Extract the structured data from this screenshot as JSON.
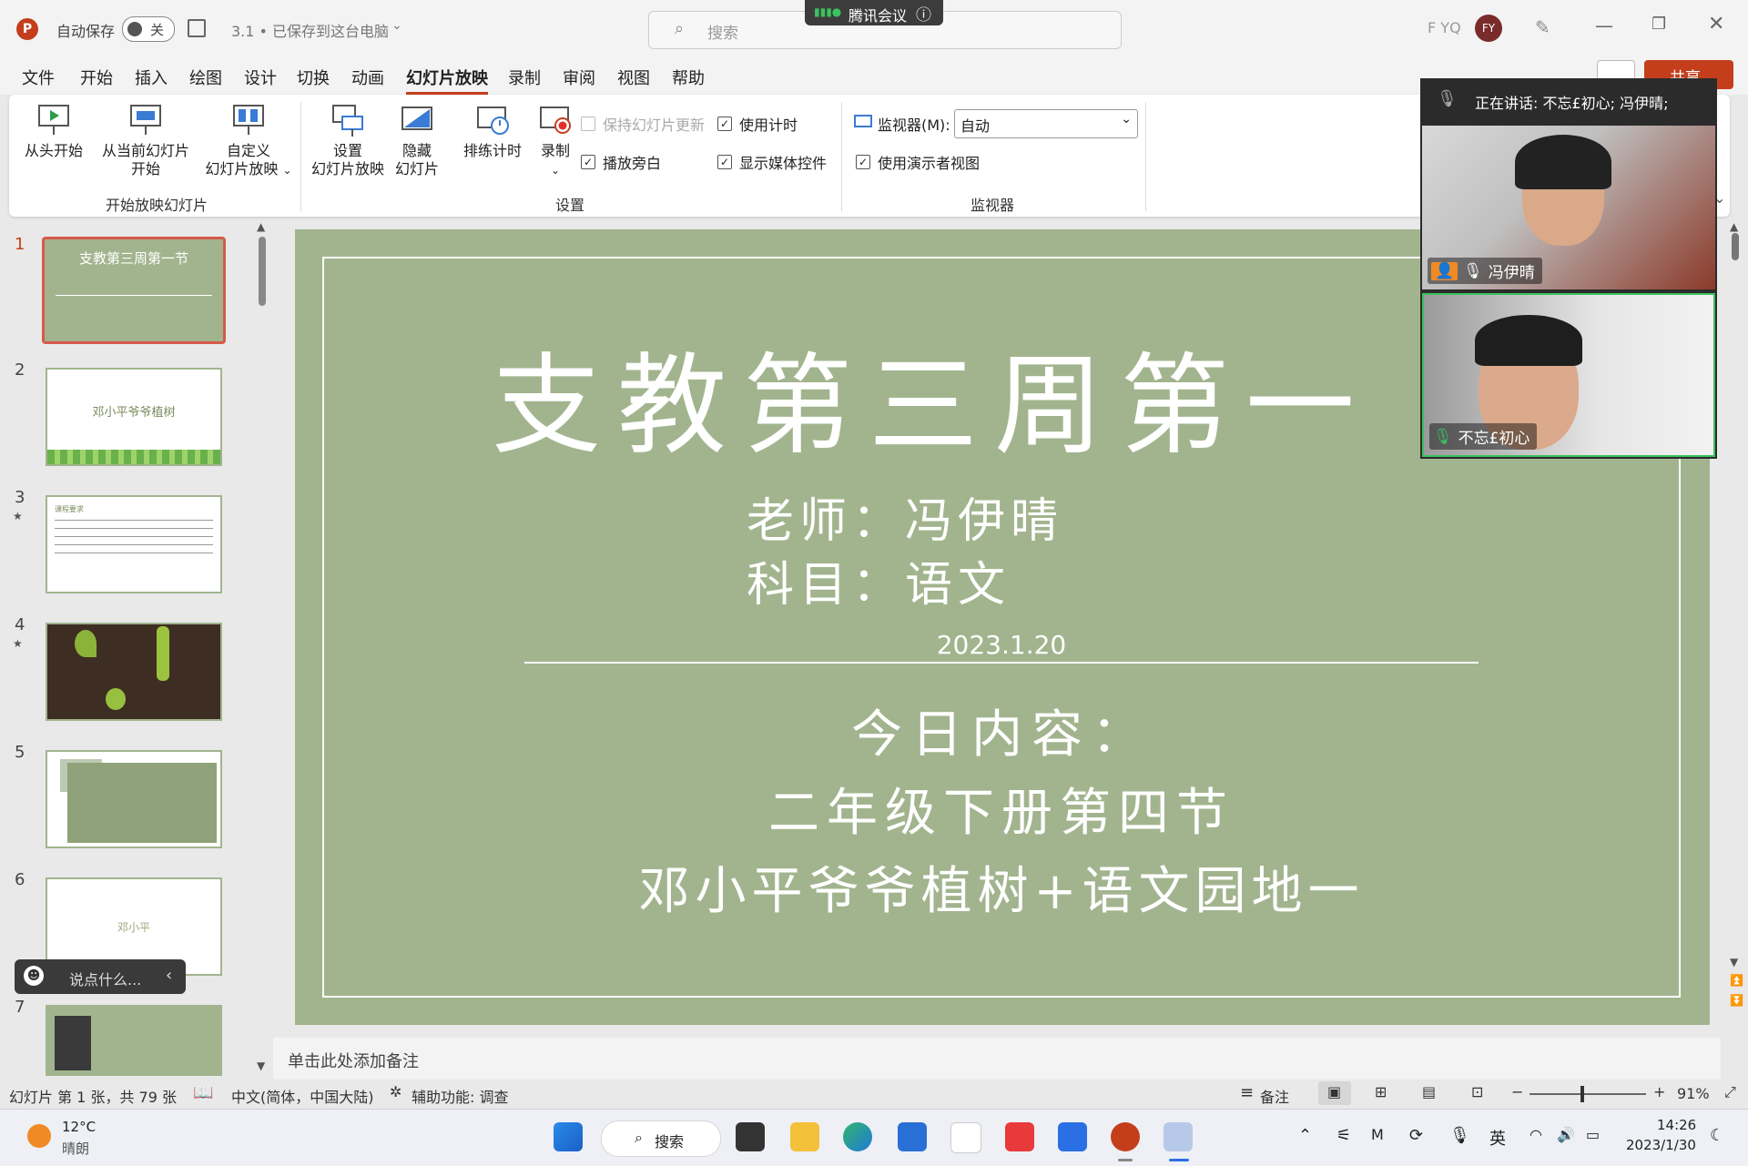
{
  "app": {
    "autosave_label": "自动保存",
    "autosave_state": "关",
    "doc_title": "3.1 • 已保存到这台电脑",
    "search_placeholder": "搜索",
    "meeting_badge": "腾讯会议",
    "user_short": "F YQ",
    "user_avatar": "FY",
    "share_label": "共享",
    "accent_color": "#c43e1c"
  },
  "menu": [
    "文件",
    "开始",
    "插入",
    "绘图",
    "设计",
    "切换",
    "动画",
    "幻灯片放映",
    "录制",
    "审阅",
    "视图",
    "帮助"
  ],
  "menu_active_index": 7,
  "ribbon": {
    "start_group": {
      "label": "开始放映幻灯片",
      "from_beginning": "从头开始",
      "from_current_1": "从当前幻灯片",
      "from_current_2": "开始",
      "custom_1": "自定义",
      "custom_2": "幻灯片放映"
    },
    "setup_group": {
      "label": "设置",
      "setup_1": "设置",
      "setup_2": "幻灯片放映",
      "hide_1": "隐藏",
      "hide_2": "幻灯片",
      "rehearse": "排练计时",
      "record": "录制",
      "keep_updated": "保持幻灯片更新",
      "play_narration": "播放旁白",
      "use_timings": "使用计时",
      "show_media": "显示媒体控件"
    },
    "monitor_group": {
      "label": "监视器",
      "monitor_label": "监视器(M):",
      "monitor_value": "自动",
      "presenter_view": "使用演示者视图"
    }
  },
  "thumbnails": [
    {
      "num": "1",
      "title": "支教第三周第一节"
    },
    {
      "num": "2",
      "title": "邓小平爷爷植树"
    },
    {
      "num": "3",
      "title": "课程要求"
    },
    {
      "num": "4",
      "title": ""
    },
    {
      "num": "5",
      "title": ""
    },
    {
      "num": "6",
      "title": "邓小平"
    },
    {
      "num": "7",
      "title": ""
    }
  ],
  "chat_placeholder": "说点什么...",
  "slide": {
    "title": "支教第三周第一",
    "teacher": "老师：冯伊晴",
    "subject": "科目：语文",
    "date": "2023.1.20",
    "today_label": "今日内容：",
    "line1": "二年级下册第四节",
    "line2": "邓小平爷爷植树+语文园地一",
    "bg_color": "#a2b48e"
  },
  "meeting": {
    "speaking": "正在讲话: 不忘£初心; 冯伊晴;",
    "participant1": "冯伊晴",
    "participant2": "不忘£初心"
  },
  "notes_placeholder": "单击此处添加备注",
  "status": {
    "slide_info": "幻灯片 第 1 张，共 79 张",
    "language": "中文(简体，中国大陆)",
    "accessibility": "辅助功能: 调查",
    "notes_btn": "备注",
    "zoom": "91%"
  },
  "taskbar": {
    "temp": "12°C",
    "weather": "晴朗",
    "search": "搜索",
    "ime": "英",
    "time": "14:26",
    "date": "2023/1/30"
  }
}
